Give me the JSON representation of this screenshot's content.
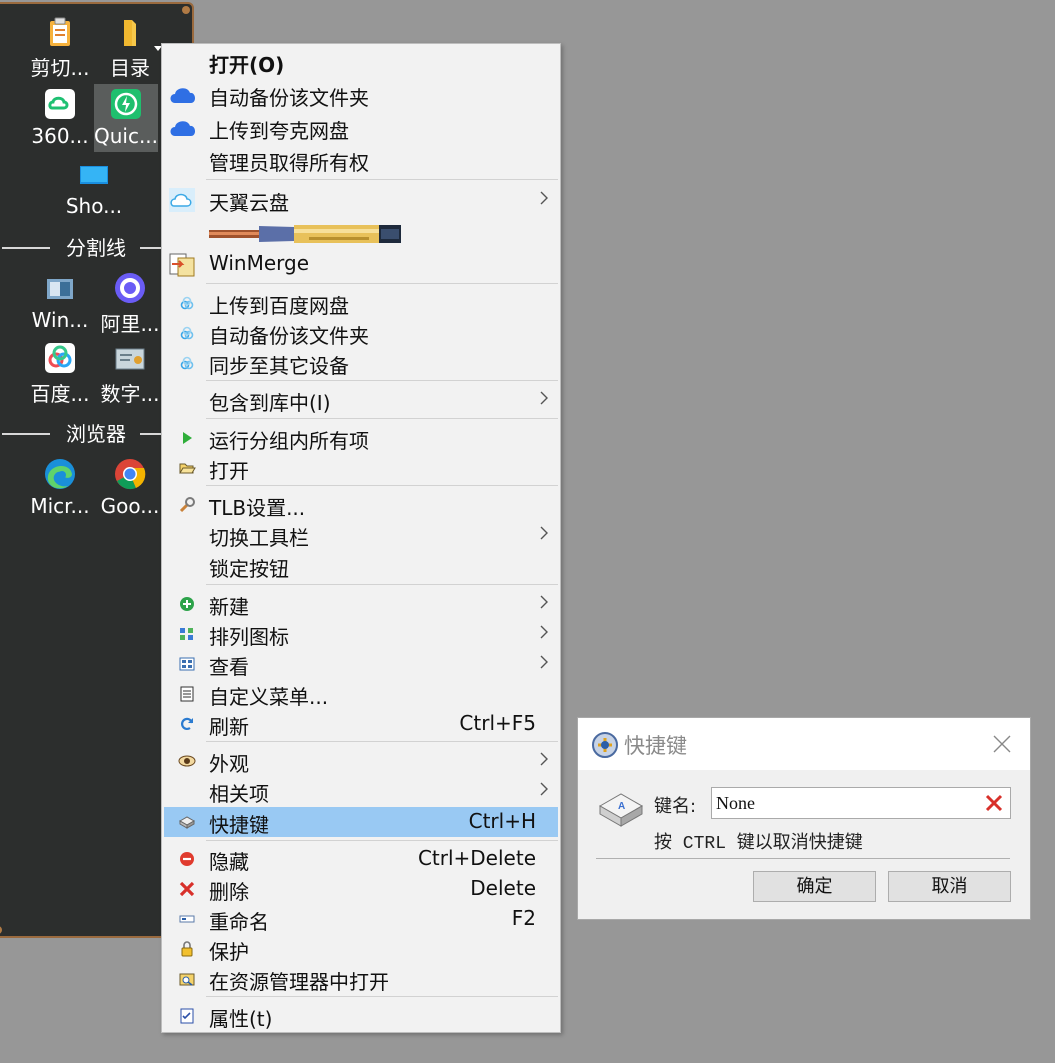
{
  "dock": {
    "items": [
      {
        "label": "剪切...",
        "icon": "clipboard-icon"
      },
      {
        "label": "目录",
        "icon": "folder-icon"
      },
      {
        "label": "360...",
        "icon": "360-cloud-icon"
      },
      {
        "label": "Quic...",
        "icon": "quicker-icon"
      },
      {
        "label": "Sho...",
        "icon": "show-desktop-icon"
      },
      {
        "label": "Win...",
        "icon": "winmerge-icon"
      },
      {
        "label": "阿里...",
        "icon": "aliyun-drive-icon"
      },
      {
        "label": "百度...",
        "icon": "baidu-netdisk-icon"
      },
      {
        "label": "数字...",
        "icon": "certificate-icon"
      },
      {
        "label": "Micr...",
        "icon": "edge-icon"
      },
      {
        "label": "Goo...",
        "icon": "chrome-icon"
      }
    ],
    "separators": [
      "分割线",
      "浏览器"
    ]
  },
  "menu": {
    "items": [
      {
        "label": "打开(O)"
      },
      {
        "label": "自动备份该文件夹",
        "icon": "quark-cloud-icon"
      },
      {
        "label": "上传到夸克网盘",
        "icon": "quark-cloud-icon"
      },
      {
        "label": "管理员取得所有权"
      },
      {
        "label": "天翼云盘",
        "icon": "tianyi-cloud-icon"
      },
      {
        "label": "",
        "icon": "bullet-banner-icon"
      },
      {
        "label": "WinMerge",
        "icon": "winmerge-icon"
      },
      {
        "label": "上传到百度网盘",
        "icon": "baidu-icon"
      },
      {
        "label": "自动备份该文件夹",
        "icon": "baidu-icon"
      },
      {
        "label": "同步至其它设备",
        "icon": "baidu-icon"
      },
      {
        "label": "包含到库中(I)"
      },
      {
        "label": "运行分组内所有项",
        "icon": "play-icon"
      },
      {
        "label": "打开",
        "icon": "folder-open-icon"
      },
      {
        "label": "TLB设置...",
        "icon": "wrench-icon"
      },
      {
        "label": "切换工具栏"
      },
      {
        "label": "锁定按钮"
      },
      {
        "label": "新建",
        "icon": "plus-icon"
      },
      {
        "label": "排列图标",
        "icon": "arrange-icon"
      },
      {
        "label": "查看",
        "icon": "view-icon"
      },
      {
        "label": "自定义菜单...",
        "icon": "custom-menu-icon"
      },
      {
        "label": "刷新",
        "icon": "refresh-icon",
        "shortcut": "Ctrl+F5"
      },
      {
        "label": "外观",
        "icon": "eye-icon"
      },
      {
        "label": "相关项"
      },
      {
        "label": "快捷键",
        "icon": "keyboard-icon",
        "shortcut": "Ctrl+H"
      },
      {
        "label": "隐藏",
        "icon": "minus-icon",
        "shortcut": "Ctrl+Delete"
      },
      {
        "label": "删除",
        "icon": "delete-x-icon",
        "shortcut": "Delete"
      },
      {
        "label": "重命名",
        "icon": "rename-icon",
        "shortcut": "F2"
      },
      {
        "label": "保护",
        "icon": "lock-icon"
      },
      {
        "label": "在资源管理器中打开",
        "icon": "explorer-icon"
      },
      {
        "label": "属性(t)",
        "icon": "properties-icon"
      }
    ]
  },
  "dialog": {
    "title": "快捷键",
    "key_label": "键名:",
    "key_value": "None",
    "hint": "按 CTRL 键以取消快捷键",
    "ok": "确定",
    "cancel": "取消"
  },
  "colors": {
    "desktop": "#979797",
    "dock_bg": "#2c2e2d",
    "dock_border": "#9a6a3e",
    "highlight": "#99c9f3"
  }
}
